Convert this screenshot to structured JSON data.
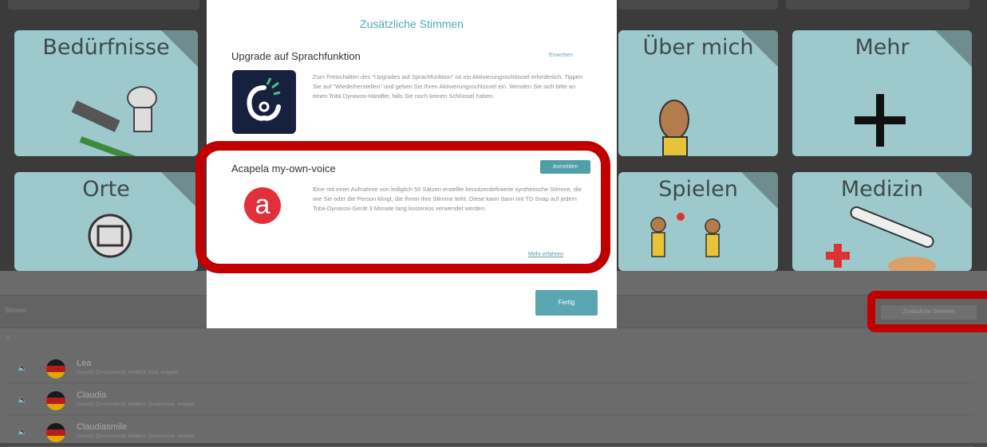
{
  "background": {
    "tiles": [
      {
        "label": "Bedürfnisse"
      },
      {
        "label": "Über mich"
      },
      {
        "label": "Mehr"
      },
      {
        "label": "Orte"
      },
      {
        "label": "Spielen"
      },
      {
        "label": "Medizin"
      }
    ]
  },
  "modal": {
    "title": "Zusätzliche Stimmen",
    "upgrade": {
      "title": "Upgrade auf Sprachfunktion",
      "action": "Erwerben",
      "description": "Zum Freischalten des \"Upgrades auf Sprachfunktion\" ist ein Aktivierungsschlüssel erforderlich. Tippen Sie auf \"Wiederherstellen\" und geben Sie Ihren Aktivierungsschlüssel ein. Wenden Sie sich bitte an einen Tobii Dynavox-Händler, falls Sie noch keinen Schlüssel haben."
    },
    "acapela": {
      "title": "Acapela my-own-voice",
      "action": "Anmelden",
      "logo_letter": "a",
      "description": "Eine mit einer Aufnahme von lediglich 50 Sätzen erstellte benutzerdefinierte synthetische Stimme, die wie Sie oder die Person klingt, die Ihnen ihre Stimme leiht. Diese kann dann mit TD Snap auf jedem Tobii-Dynavox-Gerät 3 Monate lang kostenlos verwendet werden.",
      "more_link": "Mehr erfahren"
    },
    "done_label": "Fertig"
  },
  "lower": {
    "bar_left_text": "Stimme",
    "add_voices_label": "Zusätzliche Stimmen",
    "hash": "#",
    "voices": [
      {
        "name": "Lea",
        "desc": "Deutsch (Deutschland), Weiblich, Kind, Acapela"
      },
      {
        "name": "Claudia",
        "desc": "Deutsch (Deutschland), Weiblich, Erwachsene, Acapela"
      },
      {
        "name": "Claudiasmile",
        "desc": "Deutsch (Deutschland), Weiblich, Erwachsene, Acapela"
      }
    ]
  },
  "colors": {
    "accent": "#52a9b4",
    "highlight": "#c00000",
    "tile": "#9ec9cc"
  }
}
